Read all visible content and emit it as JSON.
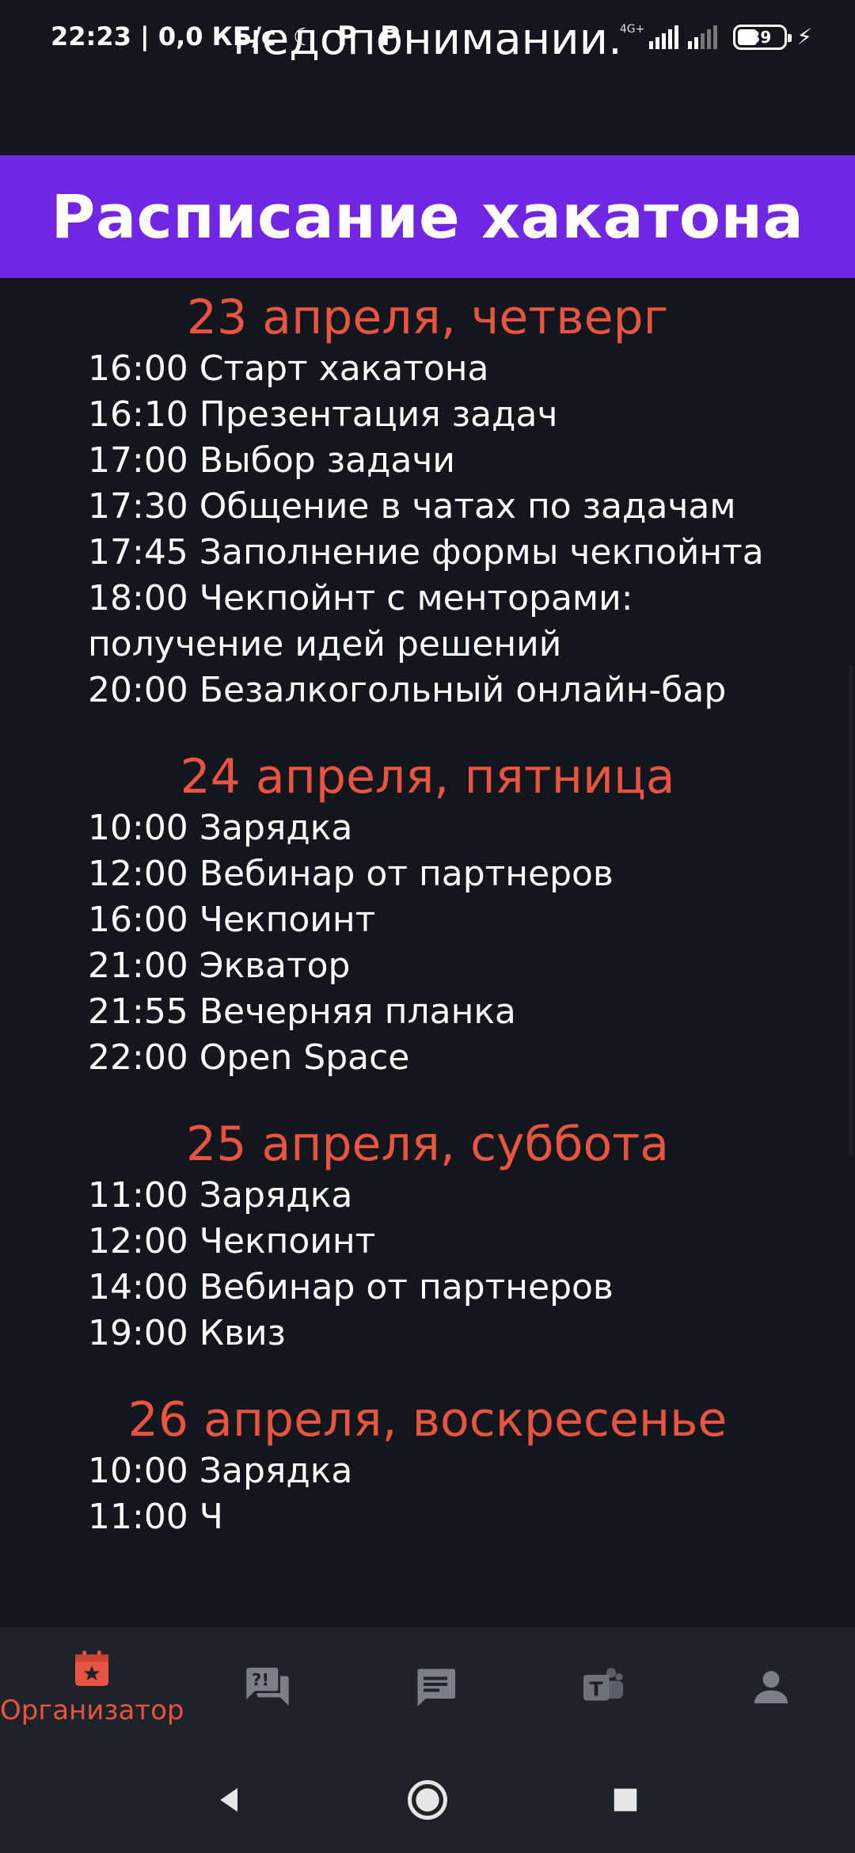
{
  "status_bar": {
    "time": "22:23",
    "speed": "0,0 КБ/с",
    "network_type": "4G+",
    "battery": "39",
    "icons": [
      "moon-icon",
      "pico-p-icon",
      "pico-p-icon",
      "signal-icon",
      "signal-icon",
      "battery-icon",
      "charging-bolt-icon"
    ]
  },
  "previous_section": {
    "cropped_text": "недопонимании."
  },
  "header": {
    "title": "Расписание хакатона",
    "background": "#7126e3"
  },
  "accent_color": "#e8543f",
  "schedule": [
    {
      "day": "23 апреля, четверг",
      "events": [
        "16:00 Старт хакатона",
        "16:10 Презентация задач",
        "17:00 Выбор задачи",
        "17:30 Общение в чатах по задачам",
        "17:45 Заполнение формы чекпойнта",
        "18:00 Чекпойнт с менторами: получение идей решений",
        "20:00 Безалкогольный онлайн-бар"
      ]
    },
    {
      "day": "24 апреля, пятница",
      "events": [
        "10:00 Зарядка",
        "12:00 Вебинар от партнеров",
        "16:00 Чекпоинт",
        "21:00 Экватор",
        "21:55 Вечерняя планка",
        "22:00 Open Space"
      ]
    },
    {
      "day": "25 апреля, суббота",
      "events": [
        "11:00 Зарядка",
        "12:00 Чекпоинт",
        "14:00 Вебинар от партнеров",
        "19:00 Квиз"
      ]
    },
    {
      "day": "26 апреля, воскресенье",
      "events": [
        "10:00 Зарядка",
        "11:00 Ч"
      ]
    }
  ],
  "bottom_nav": {
    "items": [
      {
        "label": "Организатор",
        "icon": "calendar-star-icon",
        "active": true
      },
      {
        "label": "",
        "icon": "faq-chat-icon",
        "active": false
      },
      {
        "label": "",
        "icon": "message-icon",
        "active": false
      },
      {
        "label": "",
        "icon": "teams-icon",
        "active": false
      },
      {
        "label": "",
        "icon": "person-icon",
        "active": false
      }
    ]
  },
  "system_nav": {
    "icons": [
      "back-icon",
      "home-icon",
      "recents-icon"
    ]
  }
}
